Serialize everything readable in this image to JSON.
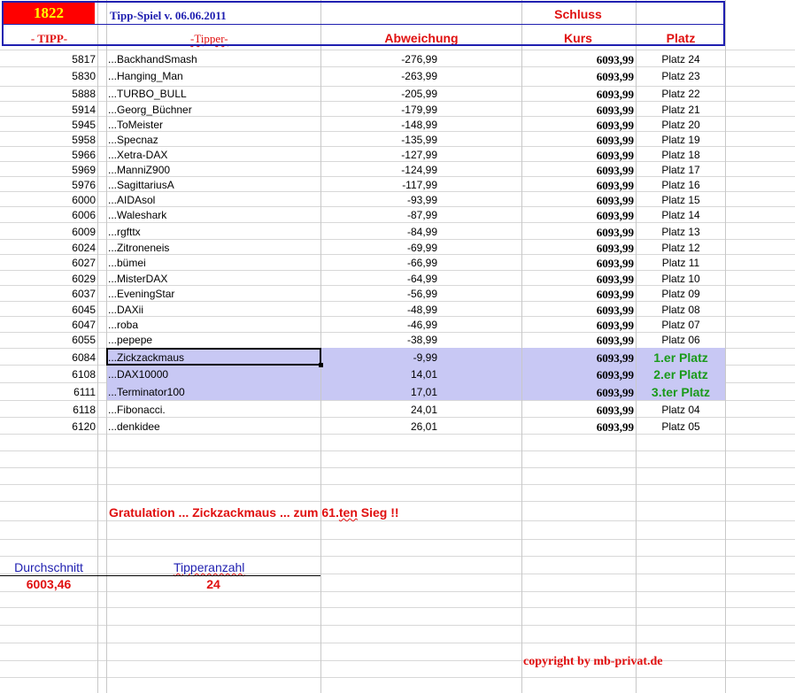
{
  "header": {
    "number": "1822",
    "title": "Tipp-Spiel v. 06.06.2011",
    "schluss": "Schluss",
    "col_tipp": "- TIPP-",
    "col_tipper": "-Tipper-",
    "col_abweichung": "Abweichung",
    "col_kurs": "Kurs",
    "col_platz": "Platz"
  },
  "rows": [
    {
      "tipp": "5817",
      "name": "...BackhandSmash",
      "abw": "-276,99",
      "kurs": "6093,99",
      "platz": "Platz 24"
    },
    {
      "tipp": "5830",
      "name": "...Hanging_Man",
      "abw": "-263,99",
      "kurs": "6093,99",
      "platz": "Platz 23"
    },
    {
      "tipp": "5888",
      "name": "...TURBO_BULL",
      "abw": "-205,99",
      "kurs": "6093,99",
      "platz": "Platz 22"
    },
    {
      "tipp": "5914",
      "name": "...Georg_Büchner",
      "abw": "-179,99",
      "kurs": "6093,99",
      "platz": "Platz 21"
    },
    {
      "tipp": "5945",
      "name": "...ToMeister",
      "abw": "-148,99",
      "kurs": "6093,99",
      "platz": "Platz 20"
    },
    {
      "tipp": "5958",
      "name": "...Specnaz",
      "abw": "-135,99",
      "kurs": "6093,99",
      "platz": "Platz 19"
    },
    {
      "tipp": "5966",
      "name": "...Xetra-DAX",
      "abw": "-127,99",
      "kurs": "6093,99",
      "platz": "Platz 18"
    },
    {
      "tipp": "5969",
      "name": "...ManniZ900",
      "abw": "-124,99",
      "kurs": "6093,99",
      "platz": "Platz 17"
    },
    {
      "tipp": "5976",
      "name": "...SagittariusA",
      "abw": "-117,99",
      "kurs": "6093,99",
      "platz": "Platz 16"
    },
    {
      "tipp": "6000",
      "name": "...AIDAsol",
      "abw": "-93,99",
      "kurs": "6093,99",
      "platz": "Platz 15"
    },
    {
      "tipp": "6006",
      "name": "...Waleshark",
      "abw": "-87,99",
      "kurs": "6093,99",
      "platz": "Platz 14"
    },
    {
      "tipp": "6009",
      "name": "...rgfttx",
      "abw": "-84,99",
      "kurs": "6093,99",
      "platz": "Platz 13"
    },
    {
      "tipp": "6024",
      "name": "...Zitroneneis",
      "abw": "-69,99",
      "kurs": "6093,99",
      "platz": "Platz 12"
    },
    {
      "tipp": "6027",
      "name": "...bümei",
      "abw": "-66,99",
      "kurs": "6093,99",
      "platz": "Platz 11"
    },
    {
      "tipp": "6029",
      "name": "...MisterDAX",
      "abw": "-64,99",
      "kurs": "6093,99",
      "platz": "Platz 10"
    },
    {
      "tipp": "6037",
      "name": "...EveningStar",
      "abw": "-56,99",
      "kurs": "6093,99",
      "platz": "Platz 09"
    },
    {
      "tipp": "6045",
      "name": "...DAXii",
      "abw": "-48,99",
      "kurs": "6093,99",
      "platz": "Platz 08"
    },
    {
      "tipp": "6047",
      "name": "...roba",
      "abw": "-46,99",
      "kurs": "6093,99",
      "platz": "Platz 07"
    },
    {
      "tipp": "6055",
      "name": "...pepepe",
      "abw": "-38,99",
      "kurs": "6093,99",
      "platz": "Platz 06"
    },
    {
      "tipp": "6084",
      "name": "...Zickzackmaus",
      "abw": "-9,99",
      "kurs": "6093,99",
      "platz": "1.er Platz"
    },
    {
      "tipp": "6108",
      "name": "...DAX10000",
      "abw": "14,01",
      "kurs": "6093,99",
      "platz": "2.er Platz"
    },
    {
      "tipp": "6111",
      "name": "...Terminator100",
      "abw": "17,01",
      "kurs": "6093,99",
      "platz": "3.ter Platz"
    },
    {
      "tipp": "6118",
      "name": "...Fibonacci.",
      "abw": "24,01",
      "kurs": "6093,99",
      "platz": "Platz 04"
    },
    {
      "tipp": "6120",
      "name": "...denkidee",
      "abw": "26,01",
      "kurs": "6093,99",
      "platz": "Platz 05"
    }
  ],
  "congrats": {
    "text": "Gratulation ... Zickzackmaus ...  zum  61.",
    "suffix": "ten",
    "end": " Sieg !!"
  },
  "summary": {
    "avg_label": "Durchschnitt",
    "avg_value": "6003,46",
    "count_label": "Tipperanzahl",
    "count_value": "24"
  },
  "copyright": "copyright by mb-privat.de",
  "colors": {
    "header_blue": "#1f1fb0",
    "accent_red": "#e01010",
    "number_cell_bg": "#ff0000",
    "number_text": "#ffff00",
    "winner_green": "#1a9a1a",
    "highlight": "#c8c8f4"
  }
}
